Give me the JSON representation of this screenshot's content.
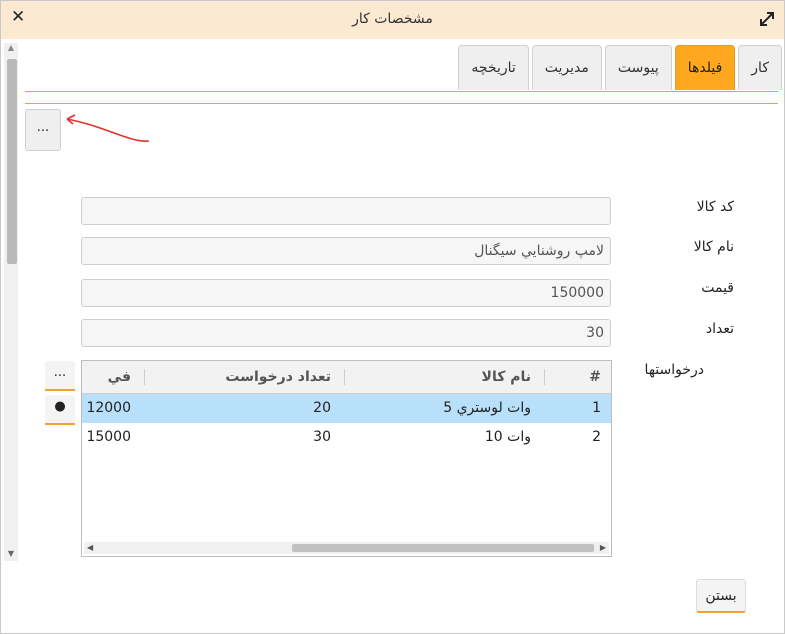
{
  "window": {
    "title": "مشخصات کار",
    "close_symbol": "✕"
  },
  "tabs": [
    {
      "label": "کار",
      "active": false
    },
    {
      "label": "فیلدها",
      "active": true
    },
    {
      "label": "پیوست",
      "active": false
    },
    {
      "label": "مدیریت",
      "active": false
    },
    {
      "label": "تاریخچه",
      "active": false
    }
  ],
  "top_button": {
    "label": "..."
  },
  "fields": {
    "code": {
      "label": "کد کالا",
      "value": ""
    },
    "name": {
      "label": "نام کالا",
      "value": "لامپ روشنايي سيگنال"
    },
    "price": {
      "label": "قیمت",
      "value": "150000"
    },
    "qty": {
      "label": "تعداد",
      "value": "30"
    }
  },
  "requests": {
    "label": "درخواستها",
    "columns": [
      "#",
      "نام کالا",
      "تعداد درخواست",
      "في"
    ],
    "rows": [
      {
        "num": "1",
        "name": "5 وات لوستري",
        "count": "20",
        "fee": "12000",
        "selected": true
      },
      {
        "num": "2",
        "name": "10 وات",
        "count": "30",
        "fee": "15000",
        "selected": false
      }
    ],
    "btn_more": "...",
    "btn_dot": "●"
  },
  "footer": {
    "close_label": "بستن"
  },
  "colors": {
    "accent": "#ffa81f",
    "titlebar": "#fbe9d2",
    "selection": "#b8e0fb",
    "annotation": "#e0332f"
  }
}
